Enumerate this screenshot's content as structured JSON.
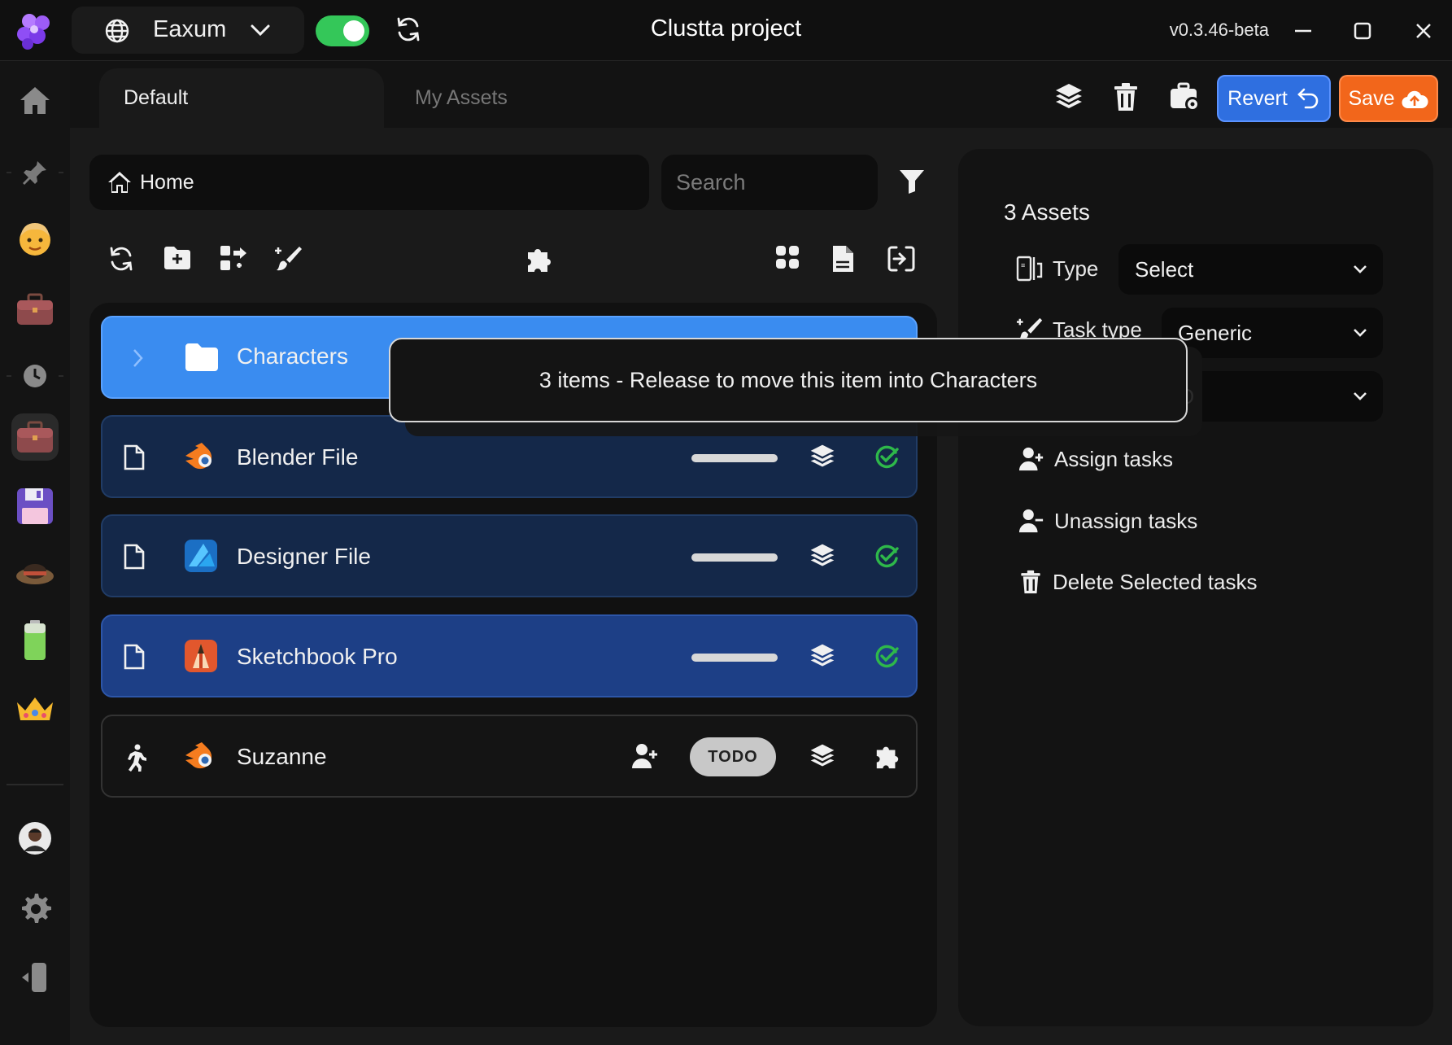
{
  "app": {
    "title": "Clustta project",
    "version": "v0.3.46-beta",
    "workspace": "Eaxum",
    "sync_enabled": true
  },
  "colors": {
    "accent_blue": "#3a8cf0",
    "revert_blue": "#2f6fe0",
    "save_orange": "#f2661b",
    "toggle_green": "#34c759",
    "done_green": "#2eb84a",
    "row_file_bg": "#142849",
    "row_selected_bg": "#1d3f86"
  },
  "tabs": [
    {
      "label": "Default",
      "active": true
    },
    {
      "label": "My Assets",
      "active": false
    }
  ],
  "toolbar": {
    "revert_label": "Revert",
    "save_label": "Save"
  },
  "breadcrumb": {
    "home": "Home"
  },
  "search": {
    "placeholder": "Search",
    "value": ""
  },
  "sidebar_icons": [
    "home-icon",
    "pin-icon",
    "user-avatar-icon",
    "briefcase-icon",
    "clock-icon",
    "briefcase-active-icon",
    "floppy-disk-icon",
    "hat-icon",
    "battery-icon",
    "crown-icon",
    "user-profile-avatar",
    "settings-icon",
    "collapse-sidebar-icon"
  ],
  "list": {
    "folder": {
      "name": "Characters",
      "icon": "folder-icon"
    },
    "files": [
      {
        "name": "Blender File",
        "app_icon": "blender-icon",
        "type_icon": "file-icon",
        "status": "done",
        "selected": false
      },
      {
        "name": "Designer File",
        "app_icon": "affinity-designer-icon",
        "type_icon": "file-icon",
        "status": "done",
        "selected": false
      },
      {
        "name": "Sketchbook Pro",
        "app_icon": "sketchbook-icon",
        "type_icon": "file-icon",
        "status": "done",
        "selected": true
      }
    ],
    "task": {
      "name": "Suzanne",
      "app_icon": "blender-icon",
      "type_icon": "running-figure-icon",
      "status": "TODO"
    }
  },
  "tooltip": {
    "text": "3 items - Release to move this item into Characters"
  },
  "right_panel": {
    "count_label": "3 Assets",
    "type_label": "Type",
    "type_value": "Select",
    "task_type_label": "Task type",
    "task_type_value": "Generic",
    "partial_value": "O",
    "actions": [
      {
        "label": "Assign tasks",
        "icon": "user-add-icon"
      },
      {
        "label": "Unassign tasks",
        "icon": "user-remove-icon"
      },
      {
        "label": "Delete Selected tasks",
        "icon": "trash-icon"
      }
    ]
  }
}
